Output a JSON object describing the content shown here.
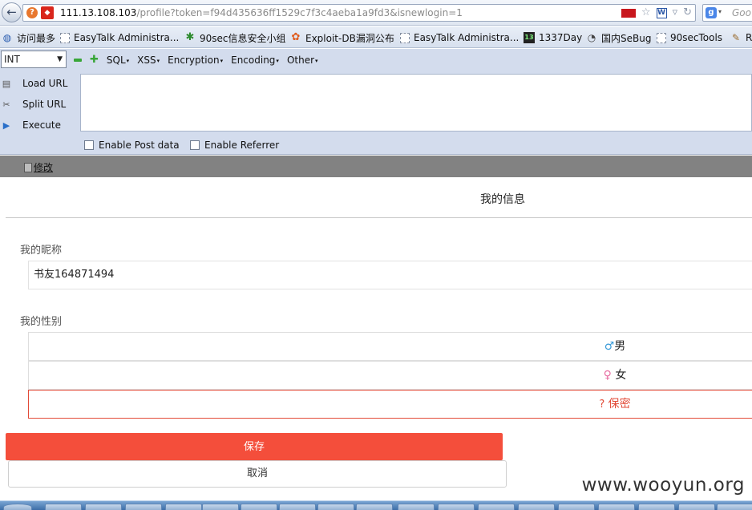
{
  "browser": {
    "back_icon": "back-arrow-icon",
    "url_host": "111.13.108.103",
    "url_path": "/profile?token=f94d435636ff1529c7f3c4aeba1a9fd3&isnewlogin=1",
    "search_placeholder": "Goo",
    "icons": [
      "help-icon",
      "site-icon",
      "flag-icon",
      "star-icon",
      "word-icon",
      "dropdown-icon",
      "refresh-icon",
      "google-icon"
    ]
  },
  "bookmarks": [
    {
      "label": "访问最多",
      "icon": "visit-icon"
    },
    {
      "label": "EasyTalk Administra...",
      "icon": "page-icon"
    },
    {
      "label": "90sec信息安全小组",
      "icon": "bug-icon"
    },
    {
      "label": "Exploit-DB漏洞公布",
      "icon": "fire-icon"
    },
    {
      "label": "EasyTalk Administra...",
      "icon": "page-icon"
    },
    {
      "label": "1337Day",
      "icon": "leet-icon"
    },
    {
      "label": "国内SeBug",
      "icon": "sebug-icon"
    },
    {
      "label": "90secTools",
      "icon": "page-icon"
    },
    {
      "label": "R",
      "icon": "tools-icon"
    }
  ],
  "hackbar": {
    "select_value": "INT",
    "menus": [
      "SQL",
      "XSS",
      "Encryption",
      "Encoding",
      "Other"
    ],
    "actions": [
      "Load URL",
      "Split URL",
      "Execute"
    ],
    "checkboxes": [
      "Enable Post data",
      "Enable Referrer"
    ]
  },
  "strip": {
    "edit_label": "修改"
  },
  "page": {
    "title": "我的信息",
    "nickname_label": "我的昵称",
    "nickname_value": "书友164871494",
    "gender_label": "我的性别",
    "gender_options": [
      {
        "symbol": "♂",
        "label": "男",
        "selected": false
      },
      {
        "symbol": "♀",
        "label": "女",
        "selected": false
      },
      {
        "symbol": "?",
        "label": "保密",
        "selected": true
      }
    ],
    "save_label": "保存",
    "cancel_label": "取消",
    "accent_color": "#f44e3b"
  },
  "watermark": "www.wooyun.org"
}
